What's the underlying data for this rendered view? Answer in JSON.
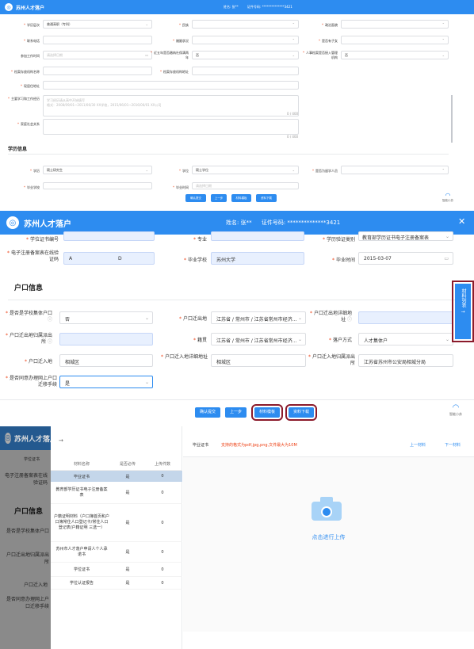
{
  "app": {
    "title": "苏州人才落户",
    "logo_glyph": "◎",
    "name_label": "姓名:",
    "name_value": "张**",
    "id_label": "证件号码:",
    "id_value": "**************3421",
    "accent": "#2d8cf0"
  },
  "panel1": {
    "r1": {
      "l1": "学历层次",
      "v1": "普通高职（专科）",
      "l2": "民族",
      "l3": "政治面貌"
    },
    "r2": {
      "l1": "联系电话",
      "l2": "婚姻状况",
      "l3": "是否有子女"
    },
    "r3": {
      "l1": "参加工作时间",
      "p1": "请选择日期",
      "l2": "近五年是否缴纳社保满两年",
      "v2": "否",
      "l3": "人事档案是否接入管理机构",
      "v3": "否"
    },
    "r4": {
      "l1": "档案存放机构名称",
      "l2": "档案存放机构地址"
    },
    "r5": {
      "l1": "现居住地址"
    },
    "r6": {
      "l1": "主要学习和工作经历",
      "p1": "学习经历请从高中开始填写",
      "p2": "格式：2008/09/01~2011/06/30 XX学校，2015/06/01~2016/06/01 XX公司",
      "count": "0 / 400"
    },
    "r7": {
      "l1": "家庭社会关系",
      "count": "0 / 400"
    },
    "sect": "学历信息",
    "r8": {
      "l1": "学历",
      "v1": "硕士研究生",
      "l2": "学位",
      "v2": "硕士学位",
      "l3": "是否为留学人员"
    },
    "r9": {
      "l1": "毕业学校",
      "l2": "毕业时间",
      "p2": "请选择日期"
    },
    "buttons": {
      "submit": "确认提交",
      "prev": "上一步",
      "template": "材料模板",
      "download": "资料下载"
    },
    "assistant": "智能小苏"
  },
  "panel2": {
    "r0": {
      "l1": "学位证书编号",
      "l2": "专业",
      "l3": "学历验证类别",
      "v3": "教育部学历证书电子注册备案表"
    },
    "r1": {
      "l1": "电子注册备案表在线验证码",
      "v1a": "A",
      "v1b": "D",
      "l2": "毕业学校",
      "v2": "苏州大学",
      "l3": "毕业时间",
      "v3": "2015-03-07"
    },
    "sect": "户口信息",
    "r2": {
      "l1": "是否是学校集体户口",
      "v1": "否",
      "l2": "户口迁出地",
      "v2": "江苏省 / 常州市 / 江苏省常州市经济...",
      "l3": "户口迁出地详细地址"
    },
    "r3": {
      "l1": "户口迁出地归属派出所",
      "l2": "籍贯",
      "v2": "江苏省 / 常州市 / 江苏省常州市经济...",
      "l3": "落户方式",
      "v3": "人才集体户"
    },
    "r4": {
      "l1": "户口迁入地",
      "v1": "相城区",
      "l2": "户口迁入地详细地址",
      "v2": "相城区",
      "l3": "户口迁入地归属派出所",
      "v3": "江苏省苏州市公安局相城分局"
    },
    "r5": {
      "l1": "是否同意办理网上户口迁移手续",
      "v1": "是"
    },
    "side_tab": "材料列表",
    "side_arrow": "→",
    "buttons": {
      "submit": "确认提交",
      "prev": "上一步",
      "template": "材料模板",
      "download": "资料下载"
    },
    "assistant": "智能小苏"
  },
  "panel3": {
    "arrow": "→",
    "cols": [
      "材料名称",
      "是否必传",
      "上传件数"
    ],
    "rows": [
      {
        "name": "毕业证书",
        "req": "是",
        "count": "0"
      },
      {
        "name": "教育部学历证书电子注册备案表",
        "req": "是",
        "count": "0"
      },
      {
        "name": "户籍证明材料（户口簿首页和户口簿常住人口登记卡/常住人口登记表/户籍证明 三选一）",
        "req": "是",
        "count": "0"
      },
      {
        "name": "苏州市人才落户申请人个人承诺书",
        "req": "是",
        "count": "0"
      },
      {
        "name": "学位证书",
        "req": "是",
        "count": "0"
      },
      {
        "name": "学位认证报告",
        "req": "是",
        "count": "0"
      }
    ],
    "cur_title": "毕业证书",
    "hint": "支持的格式为pdf,jpg,png,文件最大为10M",
    "prev": "上一材料",
    "next": "下一材料",
    "upload": "点击进行上传",
    "bg_labels": [
      "学位证书",
      "电子注册备案表在线验证码",
      "户口信息",
      "是否是学校集体户口",
      "户口迁出地归属派出所",
      "户口迁入地",
      "是否同意办理网上户口迁移手续"
    ]
  }
}
